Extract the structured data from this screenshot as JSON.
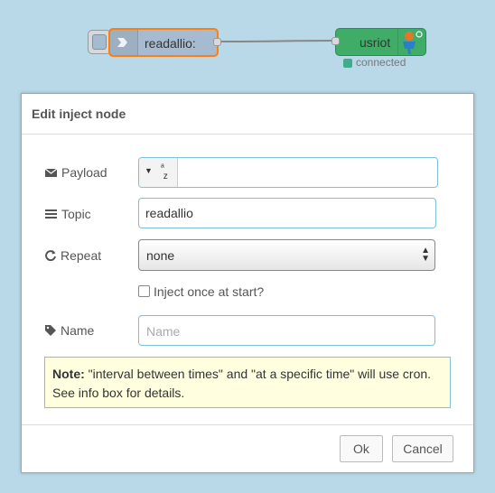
{
  "canvas": {
    "inject_node_label": "readallio:",
    "output_node_label": "usriot",
    "output_status": "connected",
    "colors": {
      "inject": "#a6bbcf",
      "selected_border": "#ff7f0e",
      "output": "#3fad68",
      "status": "#3fad8a"
    }
  },
  "dialog": {
    "title": "Edit inject node",
    "payload": {
      "label": "Payload",
      "type_icon": "string-type-icon",
      "value": ""
    },
    "topic": {
      "label": "Topic",
      "value": "readallio"
    },
    "repeat": {
      "label": "Repeat",
      "value": "none"
    },
    "inject_once": {
      "label": "Inject once at start?",
      "checked": false
    },
    "name": {
      "label": "Name",
      "placeholder": "Name",
      "value": ""
    },
    "note": {
      "bold": "Note:",
      "text": " \"interval between times\" and \"at a specific time\" will use cron. See info box for details."
    },
    "buttons": {
      "ok": "Ok",
      "cancel": "Cancel"
    }
  }
}
